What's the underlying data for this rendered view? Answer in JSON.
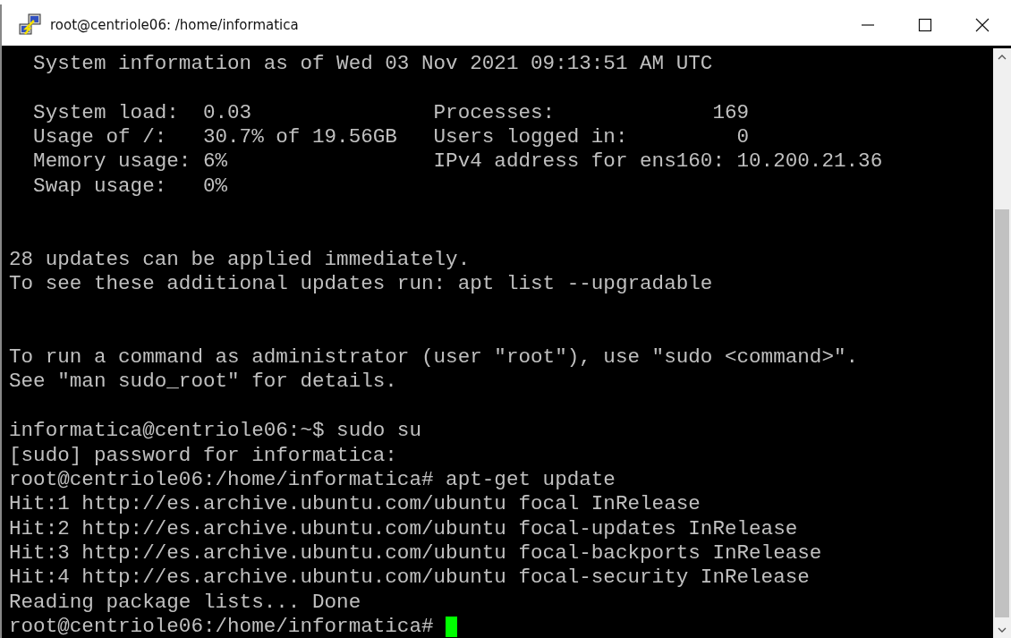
{
  "window": {
    "title": "root@centriole06: /home/informatica"
  },
  "terminal": {
    "lines": [
      {
        "kind": "text",
        "text": "  System information as of Wed 03 Nov 2021 09:13:51 AM UTC"
      },
      {
        "kind": "blank"
      },
      {
        "kind": "text",
        "text": "  System load:  0.03               Processes:             169"
      },
      {
        "kind": "text",
        "text": "  Usage of /:   30.7% of 19.56GB   Users logged in:         0"
      },
      {
        "kind": "text",
        "text": "  Memory usage: 6%                 IPv4 address for ens160: 10.200.21.36"
      },
      {
        "kind": "text",
        "text": "  Swap usage:   0%"
      },
      {
        "kind": "blank"
      },
      {
        "kind": "blank"
      },
      {
        "kind": "text",
        "text": "28 updates can be applied immediately."
      },
      {
        "kind": "text",
        "text": "To see these additional updates run: apt list --upgradable"
      },
      {
        "kind": "blank"
      },
      {
        "kind": "blank"
      },
      {
        "kind": "text",
        "text": "To run a command as administrator (user \"root\"), use \"sudo <command>\"."
      },
      {
        "kind": "text",
        "text": "See \"man sudo_root\" for details."
      },
      {
        "kind": "blank"
      },
      {
        "kind": "text",
        "text": "informatica@centriole06:~$ sudo su"
      },
      {
        "kind": "text",
        "text": "[sudo] password for informatica:"
      },
      {
        "kind": "text",
        "text": "root@centriole06:/home/informatica# apt-get update"
      },
      {
        "kind": "text",
        "text": "Hit:1 http://es.archive.ubuntu.com/ubuntu focal InRelease"
      },
      {
        "kind": "text",
        "text": "Hit:2 http://es.archive.ubuntu.com/ubuntu focal-updates InRelease"
      },
      {
        "kind": "text",
        "text": "Hit:3 http://es.archive.ubuntu.com/ubuntu focal-backports InRelease"
      },
      {
        "kind": "text",
        "text": "Hit:4 http://es.archive.ubuntu.com/ubuntu focal-security InRelease"
      },
      {
        "kind": "text",
        "text": "Reading package lists... Done"
      },
      {
        "kind": "prompt",
        "text": "root@centriole06:/home/informatica# "
      }
    ]
  }
}
